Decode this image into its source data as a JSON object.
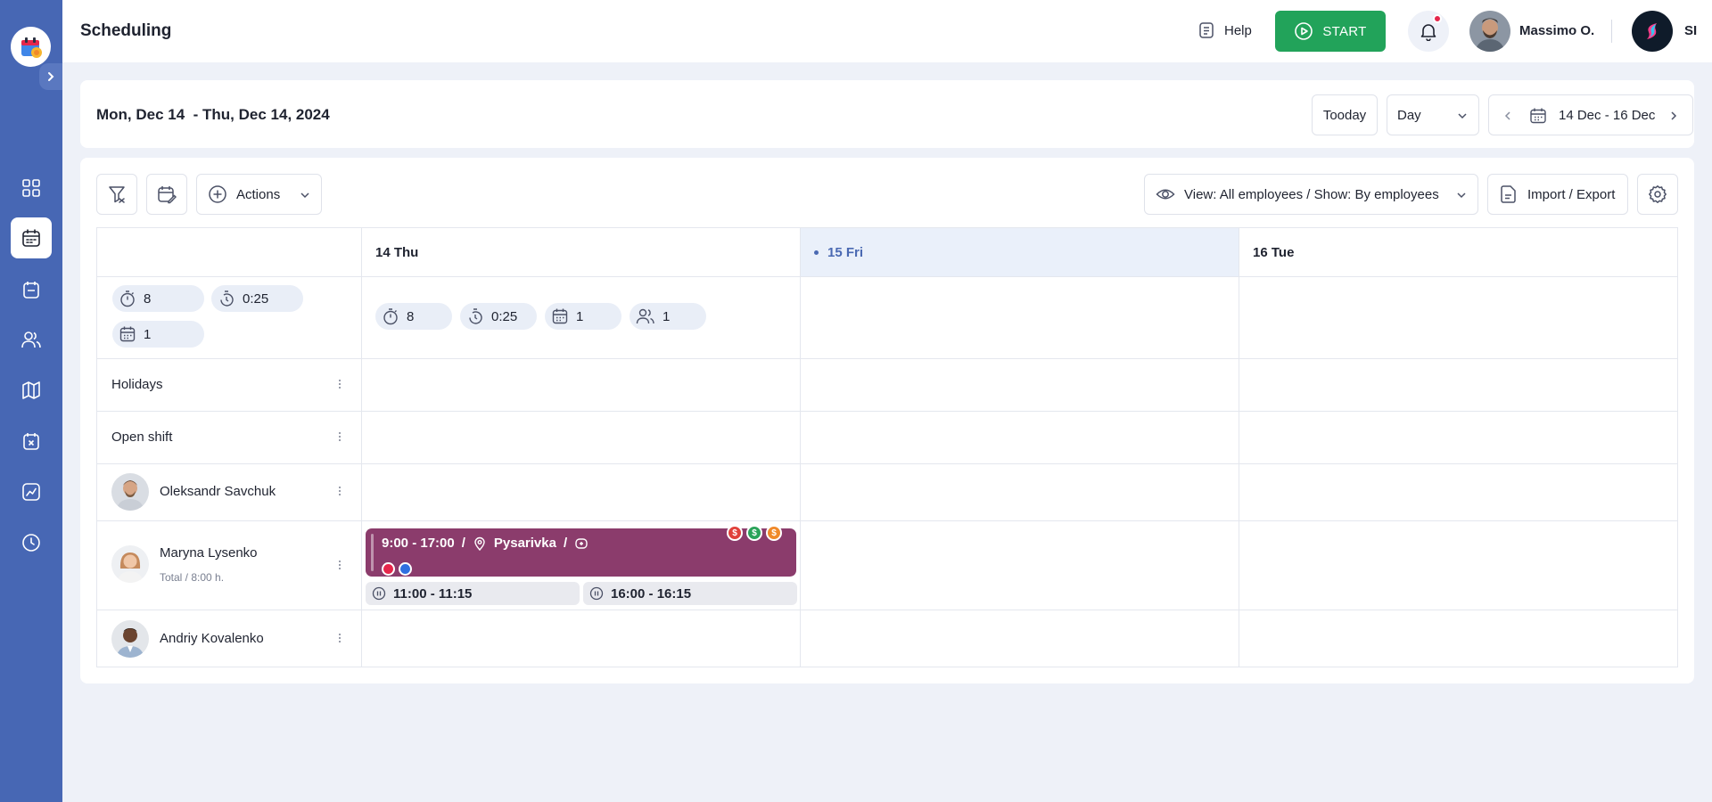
{
  "app": {
    "title": "Scheduling"
  },
  "header": {
    "help_label": "Help",
    "start_label": "START",
    "user_name": "Massimo O.",
    "company_initials": "SI"
  },
  "datebar": {
    "range_label": "Mon, Dec 14  - Thu, Dec 14, 2024",
    "today_label": "Tooday",
    "view_mode": "Day",
    "period_label": "14 Dec - 16 Dec"
  },
  "toolbar": {
    "actions_label": "Actions",
    "view_filter_label": "View: All employees / Show: By employees",
    "import_export_label": "Import / Export"
  },
  "days": [
    {
      "label": "14 Thu",
      "today": false
    },
    {
      "label": "15 Fri",
      "today": true
    },
    {
      "label": "16 Tue",
      "today": false
    }
  ],
  "summary": {
    "total": {
      "hours": "8",
      "breaks": "0:25",
      "shifts": "1"
    },
    "day1": {
      "hours": "8",
      "breaks": "0:25",
      "shifts": "1",
      "employees": "1"
    }
  },
  "rows": {
    "holidays": "Holidays",
    "open_shift": "Open shift"
  },
  "employees": [
    {
      "name": "Oleksandr Savchuk",
      "sub": ""
    },
    {
      "name": "Maryna Lysenko",
      "sub": "Total / 8:00 h."
    },
    {
      "name": "Andriy Kovalenko",
      "sub": ""
    }
  ],
  "shift": {
    "time": "9:00 - 17:00",
    "separator": "/",
    "location": "Pysarivka",
    "color": "#8b3c6c",
    "breaks": [
      "11:00 - 11:15",
      "16:00 - 16:15"
    ],
    "coin_symbol": "$",
    "coin_colors": [
      "#e0413b",
      "#2aa35a",
      "#f0892a"
    ],
    "tag_colors": [
      "#e5264b",
      "#2f6fe0"
    ]
  },
  "colors": {
    "sidebar": "#4767b4",
    "start": "#22a35a",
    "accent": "#4a69b2"
  }
}
